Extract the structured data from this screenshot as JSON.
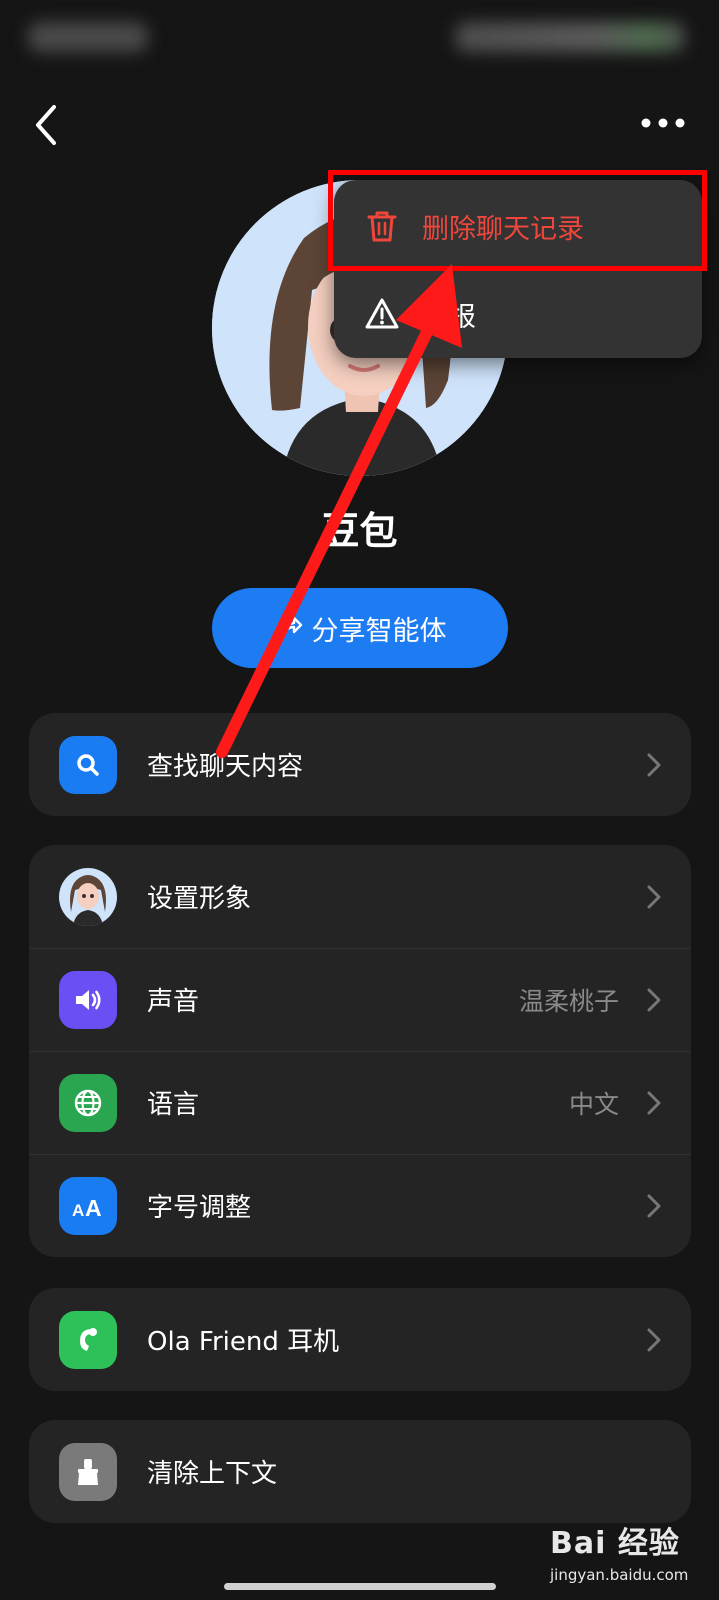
{
  "header": {
    "back_icon": "chevron-left-icon",
    "more_icon": "more-dots-icon"
  },
  "profile": {
    "name": "豆包",
    "share_label": "分享智能体"
  },
  "popup_menu": {
    "items": [
      {
        "label": "删除聊天记录",
        "icon": "trash-icon",
        "color": "#f0463c"
      },
      {
        "label": "举报",
        "icon": "warning-icon",
        "color": "#ffffff"
      }
    ]
  },
  "search_card": {
    "label": "查找聊天内容",
    "icon": "search-icon"
  },
  "settings": {
    "items": [
      {
        "label": "设置形象",
        "value": "",
        "icon": "avatar-icon"
      },
      {
        "label": "声音",
        "value": "温柔桃子",
        "icon": "speaker-icon"
      },
      {
        "label": "语言",
        "value": "中文",
        "icon": "globe-icon"
      },
      {
        "label": "字号调整",
        "value": "",
        "icon": "font-size-icon"
      }
    ]
  },
  "device_card": {
    "label": "Ola Friend 耳机",
    "icon": "earphone-icon"
  },
  "clear_card": {
    "label": "清除上下文",
    "icon": "broom-icon"
  },
  "watermark": {
    "brand": "Bai 经验",
    "url": "jingyan.baidu.com"
  },
  "colors": {
    "accent": "#1d7cf2",
    "danger": "#f0463c",
    "highlight": "#ff0000",
    "background": "#151515",
    "card": "#242424"
  }
}
